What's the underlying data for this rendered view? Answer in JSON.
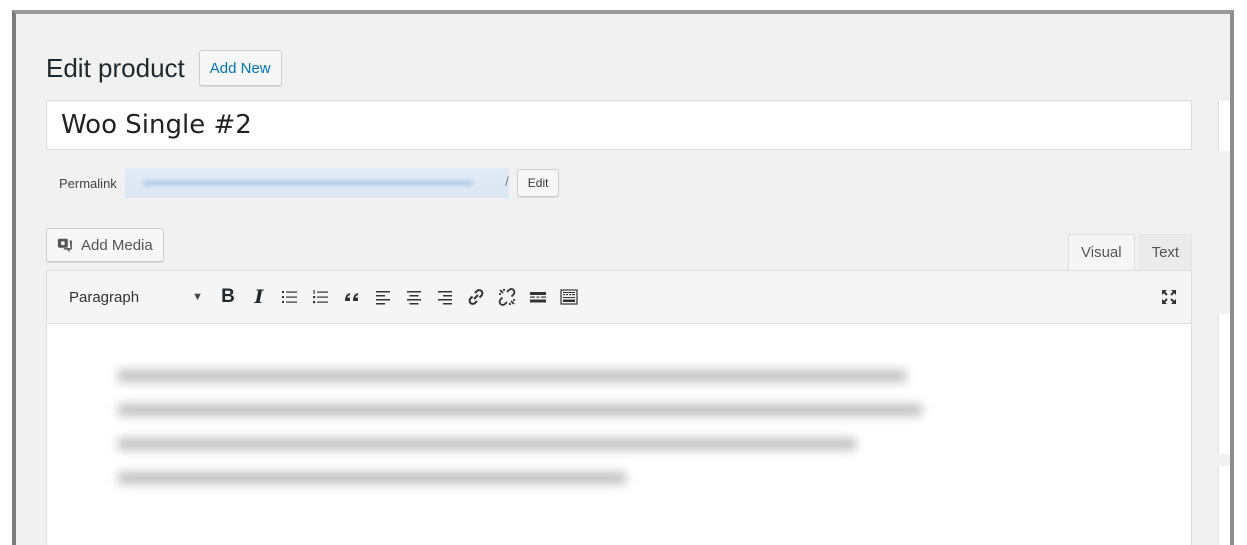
{
  "page": {
    "title": "Edit product",
    "add_new_label": "Add New"
  },
  "post": {
    "title": "Woo Single #2"
  },
  "permalink": {
    "label": "Permalink",
    "edit_label": "Edit"
  },
  "media": {
    "add_media_label": "Add Media"
  },
  "editor": {
    "tabs": [
      {
        "label": "Visual",
        "active": true
      },
      {
        "label": "Text",
        "active": false
      }
    ],
    "format_select_value": "Paragraph",
    "toolbar_icons": [
      "bold-icon",
      "italic-icon",
      "bulleted-list-icon",
      "numbered-list-icon",
      "blockquote-icon",
      "align-left-icon",
      "align-center-icon",
      "align-right-icon",
      "insert-link-icon",
      "remove-link-icon",
      "read-more-icon",
      "toolbar-toggle-icon",
      "fullscreen-icon"
    ]
  },
  "colors": {
    "link": "#0073aa",
    "background": "#f1f1f1"
  }
}
